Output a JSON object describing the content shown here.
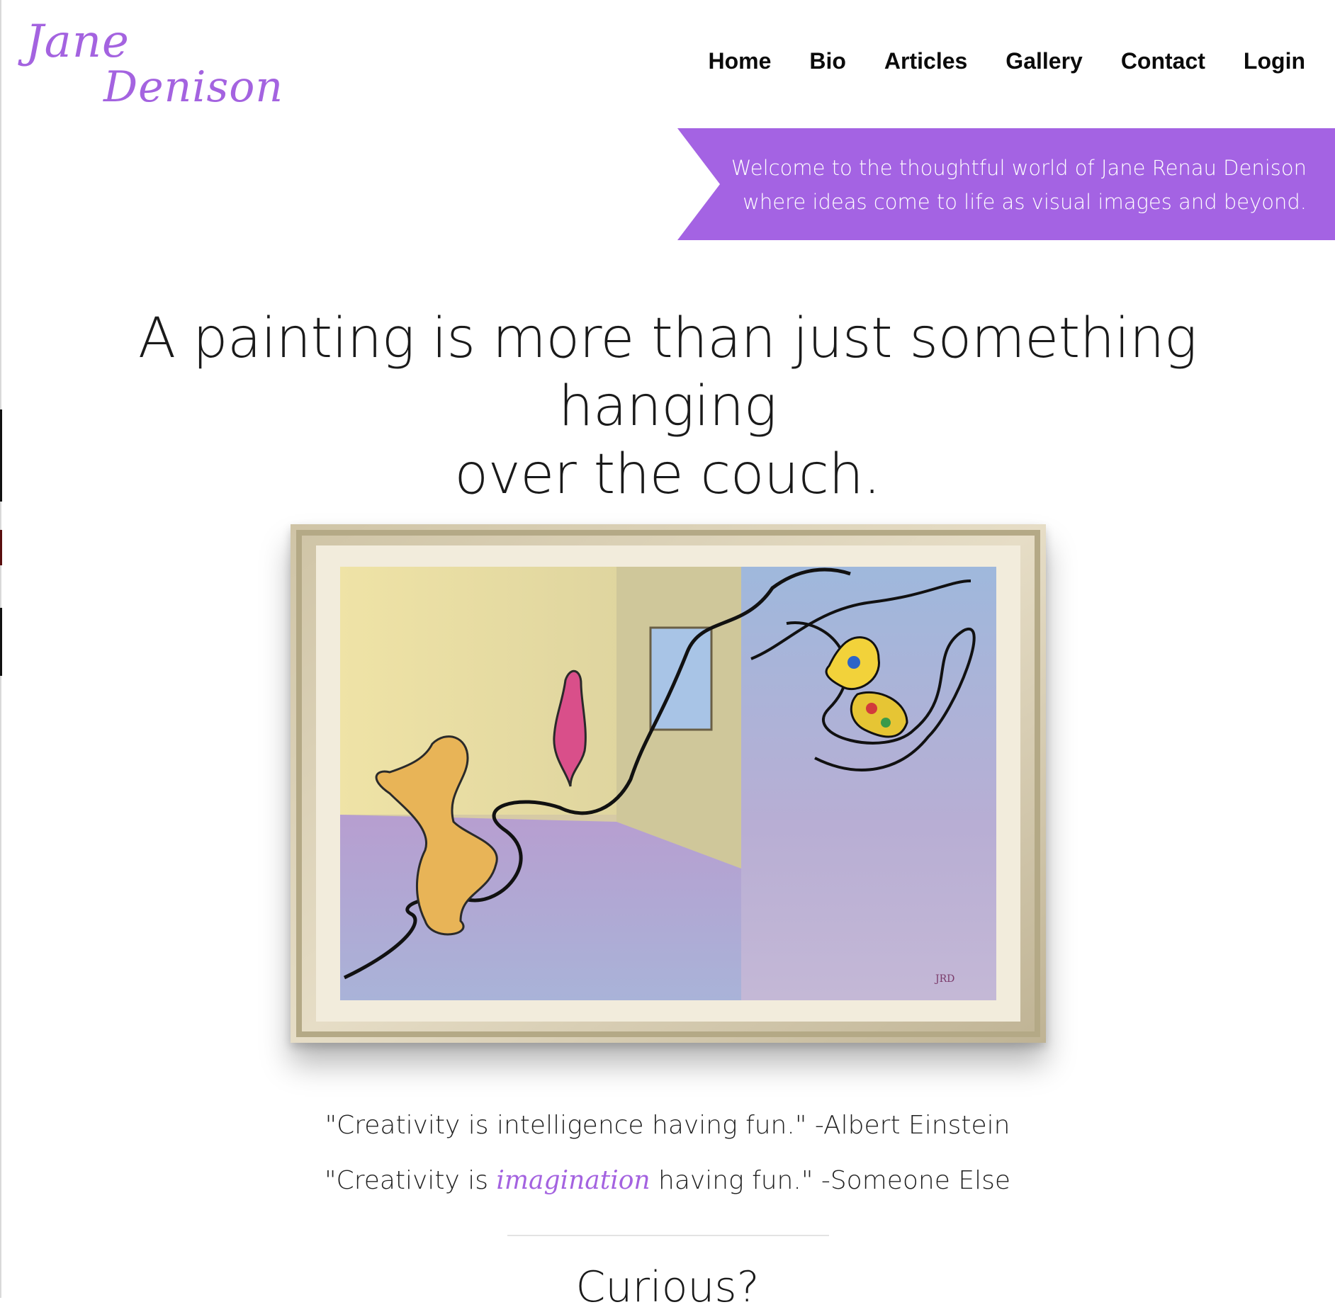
{
  "logo": {
    "line1": "Jane",
    "line2": "Denison"
  },
  "nav": [
    "Home",
    "Bio",
    "Articles",
    "Gallery",
    "Contact",
    "Login"
  ],
  "banner": {
    "line1": "Welcome to the thoughtful world of Jane Renau Denison",
    "line2": "where ideas come to life as visual images and beyond."
  },
  "headline": {
    "line1": "A painting is more than just something hanging",
    "line2": "over the couch."
  },
  "quotes": {
    "q1": "\"Creativity is intelligence having fun.\" -Albert Einstein",
    "q2_before": "\"Creativity is ",
    "q2_highlight": "imagination",
    "q2_after": " having fun.\" -Someone Else"
  },
  "section_heading": "Curious?",
  "colors": {
    "accent": "#a463e3",
    "text": "#111111"
  }
}
